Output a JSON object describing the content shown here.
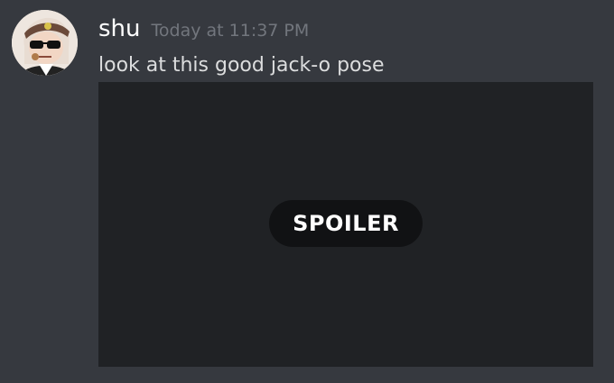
{
  "message": {
    "username": "shu",
    "timestamp": "Today at 11:37 PM",
    "content": "look at this good jack-o pose",
    "avatar_icon": "user-avatar",
    "attachment": {
      "spoiler_label": "SPOILER"
    }
  },
  "colors": {
    "background": "#36393f",
    "username": "#ffffff",
    "timestamp": "#72767d",
    "message_text": "#dcddde",
    "spoiler_background": "#202225",
    "spoiler_pill": "#111214"
  }
}
